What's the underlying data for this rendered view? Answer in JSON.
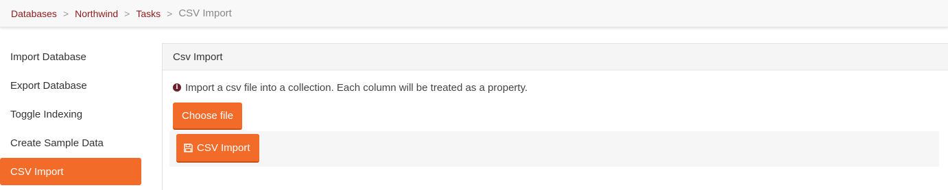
{
  "breadcrumb": {
    "items": [
      "Databases",
      "Northwind",
      "Tasks"
    ],
    "separator": ">",
    "current": "CSV Import"
  },
  "sidebar": {
    "items": [
      {
        "label": "Import Database",
        "active": false
      },
      {
        "label": "Export Database",
        "active": false
      },
      {
        "label": "Toggle Indexing",
        "active": false
      },
      {
        "label": "Create Sample Data",
        "active": false
      },
      {
        "label": "CSV Import",
        "active": true
      }
    ]
  },
  "panel": {
    "title": "Csv Import",
    "info_icon": "info-circle-icon",
    "info_text": "Import a csv file into a collection. Each column will be treated as a property.",
    "choose_file_label": "Choose file",
    "import_button_icon": "floppy-disk-icon",
    "import_button_label": "CSV Import"
  },
  "colors": {
    "accent": "#f26b28",
    "link": "#8b1a1a",
    "info_icon": "#6b1f2a"
  }
}
